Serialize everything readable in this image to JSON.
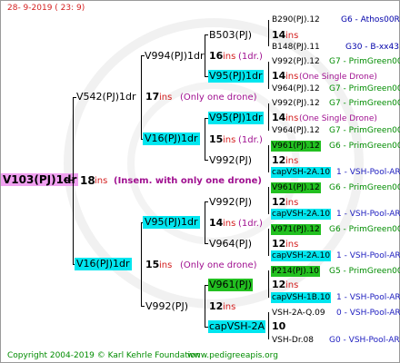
{
  "header": {
    "date": "28- 9-2019 ( 23: 9)"
  },
  "footer": {
    "copyright": "Copyright 2004-2019 © Karl Kehrle Foundation",
    "url": "www.pedigreeapis.org"
  },
  "root": {
    "name": "V103(PJ)1dr",
    "num": "18",
    "ins": "ins",
    "note": "(Insem. with only one drone)"
  },
  "g2": [
    {
      "name": "V542(PJ)1dr",
      "num": "17",
      "ins": "ins",
      "note": "(Only one drone)"
    },
    {
      "name": "V16(PJ)1dr",
      "num": "15",
      "ins": "ins",
      "note": "(Only one drone)"
    }
  ],
  "g3": [
    {
      "name": "V994(PJ)1dr",
      "num": "16",
      "ins": "ins",
      "note": "(1dr.)"
    },
    {
      "name": "V16(PJ)1dr",
      "num": "15",
      "ins": "ins",
      "note": "(1dr.)"
    },
    {
      "name": "V95(PJ)1dr",
      "num": "14",
      "ins": "ins",
      "note": "(1dr.)"
    },
    {
      "name": "V992(PJ)",
      "num": "12",
      "ins": "ins",
      "note": ""
    }
  ],
  "g4": [
    {
      "name": "B503(PJ)",
      "num": "14",
      "ins": "ins",
      "note": ""
    },
    {
      "name": "V95(PJ)1dr",
      "num": "",
      "ins": "",
      "note": ""
    },
    {
      "name": "V95(PJ)1dr",
      "num": "14",
      "ins": "ins",
      "note": "(1dr.)"
    },
    {
      "name": "V992(PJ)",
      "num": "12",
      "ins": "ins",
      "note": ""
    },
    {
      "name": "V992(PJ)",
      "num": "12",
      "ins": "ins",
      "note": ""
    },
    {
      "name": "V964(PJ)",
      "num": "12",
      "ins": "ins",
      "note": ""
    },
    {
      "name": "V961(PJ)",
      "num": "12",
      "ins": "ins",
      "note": ""
    },
    {
      "name": "capVSH-2A",
      "num": "10",
      "ins": "",
      "note": ""
    }
  ],
  "g5": [
    {
      "name": "B290(PJ).12",
      "src": "G6 - Athos00R"
    },
    {
      "name": "B148(PJ).11",
      "src": "G30 - B-xx43"
    },
    {
      "name": "V992(PJ).12",
      "src": "G7 - PrimGreen00"
    },
    {
      "name": "V964(PJ).12",
      "src": "G7 - PrimGreen00"
    },
    {
      "name": "V992(PJ).12",
      "src": "G7 - PrimGreen00"
    },
    {
      "name": "V964(PJ).12",
      "src": "G7 - PrimGreen00"
    },
    {
      "name": "V961(PJ).12",
      "src": "G6 - PrimGreen00"
    },
    {
      "name": "capVSH-2A.10",
      "src": "1 - VSH-Pool-AR"
    },
    {
      "name": "V961(PJ).12",
      "src": "G6 - PrimGreen00"
    },
    {
      "name": "capVSH-2A.10",
      "src": "1 - VSH-Pool-AR"
    },
    {
      "name": "V971(PJ).12",
      "src": "G6 - PrimGreen00"
    },
    {
      "name": "capVSH-2A.10",
      "src": "1 - VSH-Pool-AR"
    },
    {
      "name": "P214(PJ).10",
      "src": "G5 - PrimGreen00"
    },
    {
      "name": "capVSH-1B.10",
      "src": "1 - VSH-Pool-AR"
    },
    {
      "name": "VSH-2A-Q.09",
      "src": "0 - VSH-Pool-AR"
    },
    {
      "name": "VSH-Dr.08",
      "src": "G0 - VSH-Pool-AR"
    }
  ],
  "g5notes": {
    "single": "(One Single Drone)",
    "ins": "ins",
    "n14": "14",
    "n12": "12"
  }
}
